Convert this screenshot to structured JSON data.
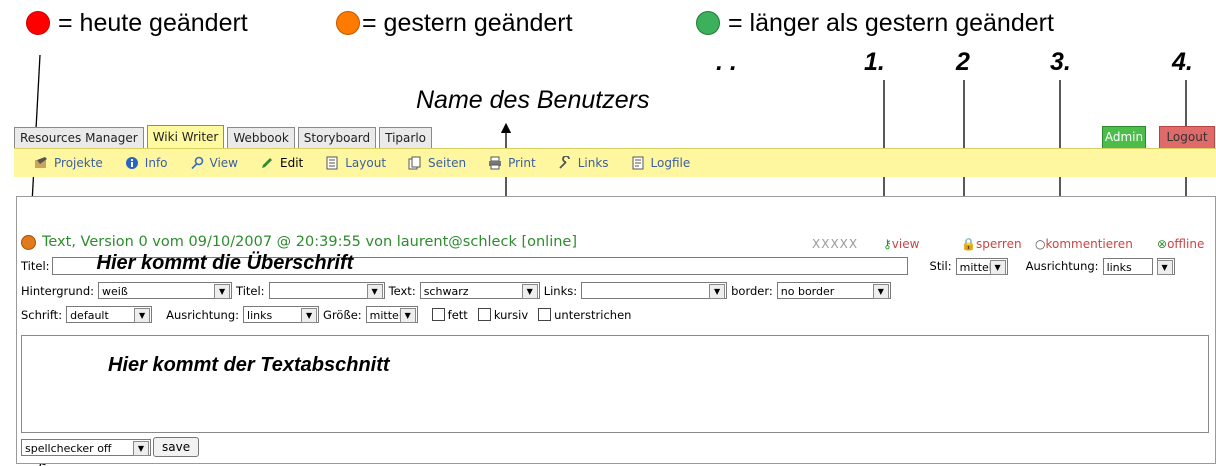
{
  "legend": {
    "today": {
      "label": "= heute geändert",
      "color": "#ff0000"
    },
    "yesterday": {
      "label": "= gestern geändert",
      "color": "#ff7a00"
    },
    "older": {
      "label": "= länger als gestern geändert",
      "color": "#3cb05a"
    }
  },
  "annotations": {
    "dots": ". .",
    "n1": "1.",
    "n2": "2",
    "n3": "3.",
    "n4": "4.",
    "user_name": "Name des Benutzers",
    "heading_hint": "Hier kommt die Überschrift",
    "text_hint": "Hier kommt der Textabschnitt"
  },
  "tabs": [
    "Resources Manager",
    "Wiki Writer",
    "Webbook",
    "Storyboard",
    "Tiparlo"
  ],
  "admin_label": "Admin",
  "logout_label": "Logout",
  "menu": [
    "Projekte",
    "Info",
    "View",
    "Edit",
    "Layout",
    "Seiten",
    "Print",
    "Links",
    "Logfile"
  ],
  "editor": {
    "version_text": "Text, Version 0 vom 09/10/2007 @ 20:39:55 von laurent@schleck [online]",
    "xxxxx": "XXXXX",
    "actions": {
      "view": "view",
      "lock": "sperren",
      "comment": "kommentieren",
      "offline": "offline"
    },
    "titel_label": "Titel:",
    "stil_label": "Stil:",
    "stil_value": "mittel",
    "ausrichtung_label": "Ausrichtung:",
    "ausrichtung_value": "links",
    "hintergrund_label": "Hintergrund:",
    "hintergrund_value": "weiß",
    "titel2_label": "Titel:",
    "titel2_value": "",
    "text_label": "Text:",
    "text_value": "schwarz",
    "links_label": "Links:",
    "links_value": "",
    "border_label": "border:",
    "border_value": "no border",
    "schrift_label": "Schrift:",
    "schrift_value": "default",
    "ausrichtung2_label": "Ausrichtung:",
    "ausrichtung2_value": "links",
    "groesse_label": "Größe:",
    "groesse_value": "mittel",
    "fett_label": "fett",
    "kursiv_label": "kursiv",
    "unterstrichen_label": "unterstrichen",
    "spellchecker_value": "spellchecker off",
    "save_label": "save"
  }
}
